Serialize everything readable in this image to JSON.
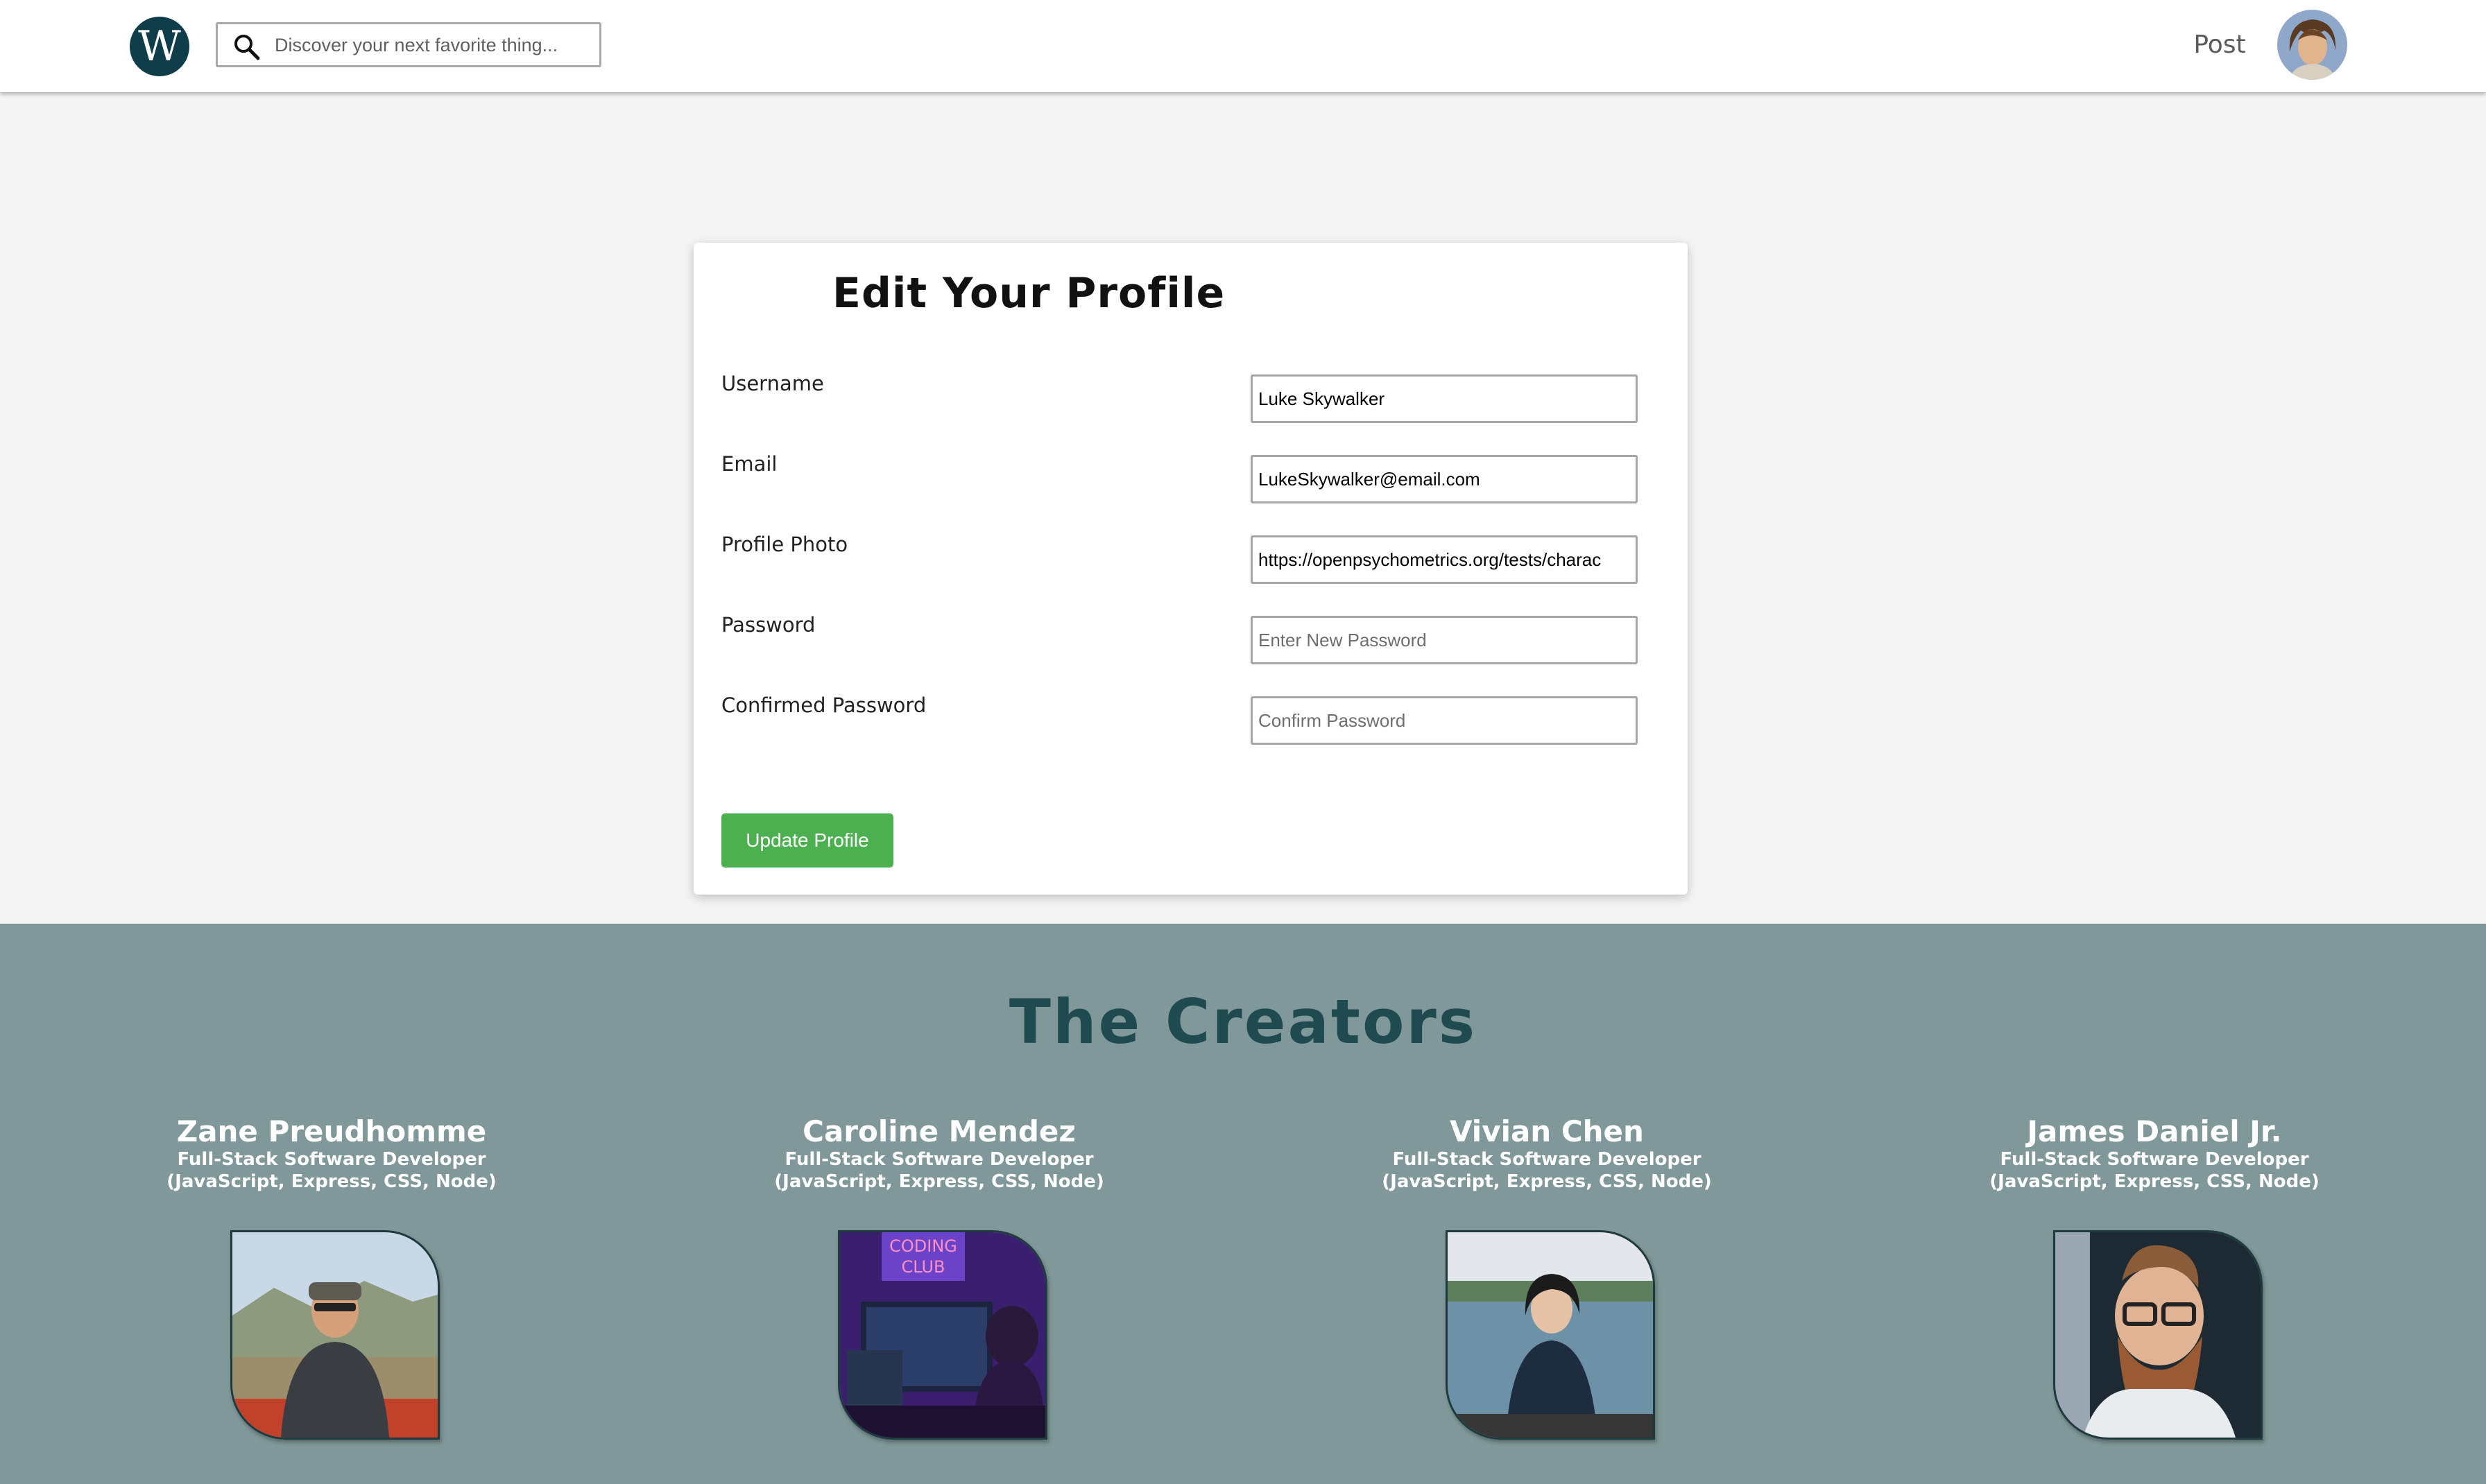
{
  "header": {
    "logo_letter": "W",
    "search_placeholder": "Discover your next favorite thing...",
    "post_label": "Post"
  },
  "form": {
    "title": "Edit Your Profile",
    "fields": [
      {
        "label": "Username",
        "value": "Luke Skywalker",
        "placeholder": ""
      },
      {
        "label": "Email",
        "value": "LukeSkywalker@email.com",
        "placeholder": ""
      },
      {
        "label": "Profile Photo",
        "value": "https://openpsychometrics.org/tests/charac",
        "placeholder": ""
      },
      {
        "label": "Password",
        "value": "",
        "placeholder": "Enter New Password"
      },
      {
        "label": "Confirmed Password",
        "value": "",
        "placeholder": "Confirm Password"
      }
    ],
    "submit_label": "Update Profile"
  },
  "creators": {
    "title": "The Creators",
    "people": [
      {
        "name": "Zane Preudhomme",
        "role_line1": "Full-Stack Software Developer",
        "role_line2": "(JavaScript, Express, CSS, Node)"
      },
      {
        "name": "Caroline Mendez",
        "role_line1": "Full-Stack Software Developer",
        "role_line2": "(JavaScript, Express, CSS, Node)",
        "photo_sign_line1": "CODING",
        "photo_sign_line2": "CLUB"
      },
      {
        "name": "Vivian Chen",
        "role_line1": "Full-Stack Software Developer",
        "role_line2": "(JavaScript, Express, CSS, Node)"
      },
      {
        "name": "James Daniel Jr.",
        "role_line1": "Full-Stack Software Developer",
        "role_line2": "(JavaScript, Express, CSS, Node)"
      }
    ]
  },
  "colors": {
    "logo_bg": "#0f3e4a",
    "button_green": "#4caf50",
    "creators_bg": "#809899",
    "creators_title": "#1f4b50"
  }
}
